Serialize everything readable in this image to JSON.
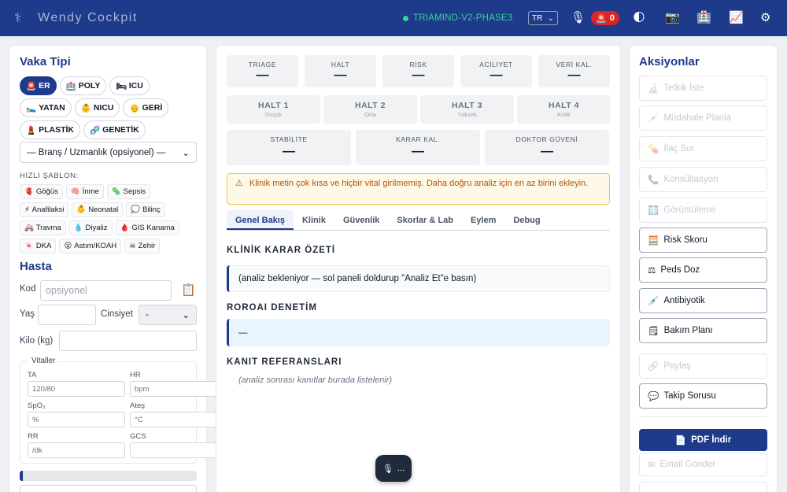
{
  "header": {
    "title": "Wendy  Cockpit",
    "phase": "TRIAMIND-V2-PHASE3",
    "lang": "TR",
    "alarm_count": "0"
  },
  "left": {
    "vaka_title": "Vaka Tipi",
    "case_types": [
      {
        "icon": "🚨",
        "label": "ER",
        "active": true
      },
      {
        "icon": "🏥",
        "label": "POLY"
      },
      {
        "icon": "🛏",
        "label": "ICU"
      },
      {
        "icon": "🛌",
        "label": "YATAN"
      },
      {
        "icon": "👶",
        "label": "NICU"
      },
      {
        "icon": "👴",
        "label": "GERİ"
      },
      {
        "icon": "💄",
        "label": "PLASTİK"
      },
      {
        "icon": "🧬",
        "label": "GENETİK"
      }
    ],
    "branch_select": "— Branş / Uzmanlık (opsiyonel) —",
    "templates_label": "HIZLI ŞABLON:",
    "templates": [
      {
        "icon": "🫀",
        "label": "Göğüs"
      },
      {
        "icon": "🧠",
        "label": "İnme"
      },
      {
        "icon": "🦠",
        "label": "Sepsis"
      },
      {
        "icon": "⚡",
        "label": "Anafilaksi"
      },
      {
        "icon": "👶",
        "label": "Neonatal"
      },
      {
        "icon": "💭",
        "label": "Bilinç"
      },
      {
        "icon": "🚑",
        "label": "Travma"
      },
      {
        "icon": "💧",
        "label": "Diyaliz"
      },
      {
        "icon": "🩸",
        "label": "GIS Kanama"
      },
      {
        "icon": "🍬",
        "label": "DKA"
      },
      {
        "icon": "😮",
        "label": "Astım/KOAH"
      },
      {
        "icon": "☠",
        "label": "Zehir"
      }
    ],
    "patient_title": "Hasta",
    "kod_label": "Kod",
    "kod_placeholder": "opsiyonel",
    "yas_label": "Yaş",
    "cinsiyet_label": "Cinsiyet",
    "cinsiyet_value": "-",
    "kilo_label": "Kilo (kg)",
    "vitals_legend": "Vitaller",
    "vitals": [
      {
        "label": "TA",
        "placeholder": "120/80"
      },
      {
        "label": "HR",
        "placeholder": "bpm"
      },
      {
        "label": "SpO₂",
        "placeholder": "%"
      },
      {
        "label": "Ateş",
        "placeholder": "°C"
      },
      {
        "label": "RR",
        "placeholder": "/dk"
      },
      {
        "label": "GCS",
        "placeholder": ""
      }
    ]
  },
  "center": {
    "stats": [
      {
        "label": "TRIAGE",
        "value": "—"
      },
      {
        "label": "HALT",
        "value": "—"
      },
      {
        "label": "RİSK",
        "value": "—"
      },
      {
        "label": "ACİLİYET",
        "value": "—"
      },
      {
        "label": "VERİ KAL.",
        "value": "—"
      }
    ],
    "halts": [
      {
        "label": "HALT 1",
        "sub": "Düşük"
      },
      {
        "label": "HALT 2",
        "sub": "Orta"
      },
      {
        "label": "HALT 3",
        "sub": "Yüksek"
      },
      {
        "label": "HALT 4",
        "sub": "Kritik"
      }
    ],
    "stats2": [
      {
        "label": "STABİLİTE",
        "value": "—"
      },
      {
        "label": "KARAR KAL.",
        "value": "—"
      },
      {
        "label": "DOKTOR GÜVENİ",
        "value": "—"
      }
    ],
    "warning": "Klinik metin çok kısa ve hiçbir vital girilmemiş. Daha doğru analiz için en az birini ekleyin.",
    "tabs": [
      "Genel Bakış",
      "Klinik",
      "Güvenlik",
      "Skorlar & Lab",
      "Eylem",
      "Debug"
    ],
    "summary_title": "KLİNİK KARAR ÖZETİ",
    "summary_text": "(analiz bekleniyor — sol paneli doldurup \"Analiz Et\"e basın)",
    "audit_title": "ROROAI DENETİM",
    "audit_text": "—",
    "evidence_title": "KANIT REFERANSLARI",
    "evidence_text": "(analiz sonrası kanıtlar burada listelenir)",
    "toast_text": "..."
  },
  "right": {
    "title": "Aksiyonlar",
    "actions": [
      {
        "icon": "🔬",
        "label": "Tetkik İste",
        "enabled": false
      },
      {
        "icon": "💉",
        "label": "Müdahale Planla",
        "enabled": false
      },
      {
        "icon": "💊",
        "label": "İlaç Sor",
        "enabled": false
      },
      {
        "icon": "📞",
        "label": "Konsültasyon",
        "enabled": false
      },
      {
        "icon": "🩻",
        "label": "Görüntüleme",
        "enabled": false
      },
      {
        "icon": "🧮",
        "label": "Risk Skoru",
        "enabled": true
      },
      {
        "icon": "⚖",
        "label": "Peds Doz",
        "enabled": true
      },
      {
        "icon": "💉",
        "label": "Antibiyotik",
        "enabled": true
      },
      {
        "icon": "🗒",
        "label": "Bakım Planı",
        "enabled": true
      },
      {
        "icon": "🔗",
        "label": "Paylaş",
        "enabled": false
      },
      {
        "icon": "💬",
        "label": "Takip Sorusu",
        "enabled": true
      }
    ],
    "pdf_label": "PDF İndir",
    "email_label": "Email Gönder"
  }
}
